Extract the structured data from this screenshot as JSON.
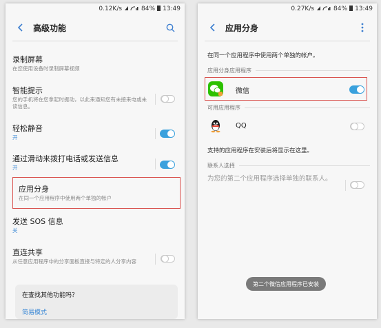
{
  "left": {
    "status": {
      "speed": "0.12K/s",
      "battery": "84%",
      "time": "13:49"
    },
    "title": "高级功能",
    "items": [
      {
        "title": "录制屏幕",
        "sub": "在您使用设备时录制屏幕视频"
      },
      {
        "title": "智能提示",
        "sub": "您的手机将在您拿起时振动，以此来通知您有未接来电或未读信息。",
        "toggle": false
      },
      {
        "title": "轻松静音",
        "sub": "开",
        "toggle": true
      },
      {
        "title": "通过滑动来拨打电话或发送信息",
        "sub": "开",
        "toggle": true
      },
      {
        "title": "应用分身",
        "sub": "在同一个应用程序中使用两个单独的帐户"
      },
      {
        "title": "发送 SOS 信息",
        "sub": "关"
      },
      {
        "title": "直连共享",
        "sub": "从任意应用程序中的分享面板直接与特定的人分享内容",
        "toggle": false
      }
    ],
    "help": {
      "question": "在查找其他功能吗？",
      "link": "简易模式"
    }
  },
  "right": {
    "status": {
      "speed": "0.27K/s",
      "battery": "84%",
      "time": "13:49"
    },
    "title": "应用分身",
    "description": "在同一个应用程序中使用两个单独的帐户。",
    "section_installed": "应用分身应用程序",
    "wechat": {
      "name": "微信",
      "toggle": true
    },
    "section_available": "可用应用程序",
    "qq": {
      "name": "QQ",
      "toggle": false
    },
    "supported_note": "支持的应用程序在安装后将显示在这里。",
    "section_contacts": "联系人选择",
    "contacts_text": "为您的第二个应用程序选择单独的联系人。",
    "toast": "第二个微信应用程序已安装"
  },
  "colors": {
    "accent": "#3aa1dd",
    "highlight": "#d9534f",
    "wechat": "#2dc100"
  }
}
